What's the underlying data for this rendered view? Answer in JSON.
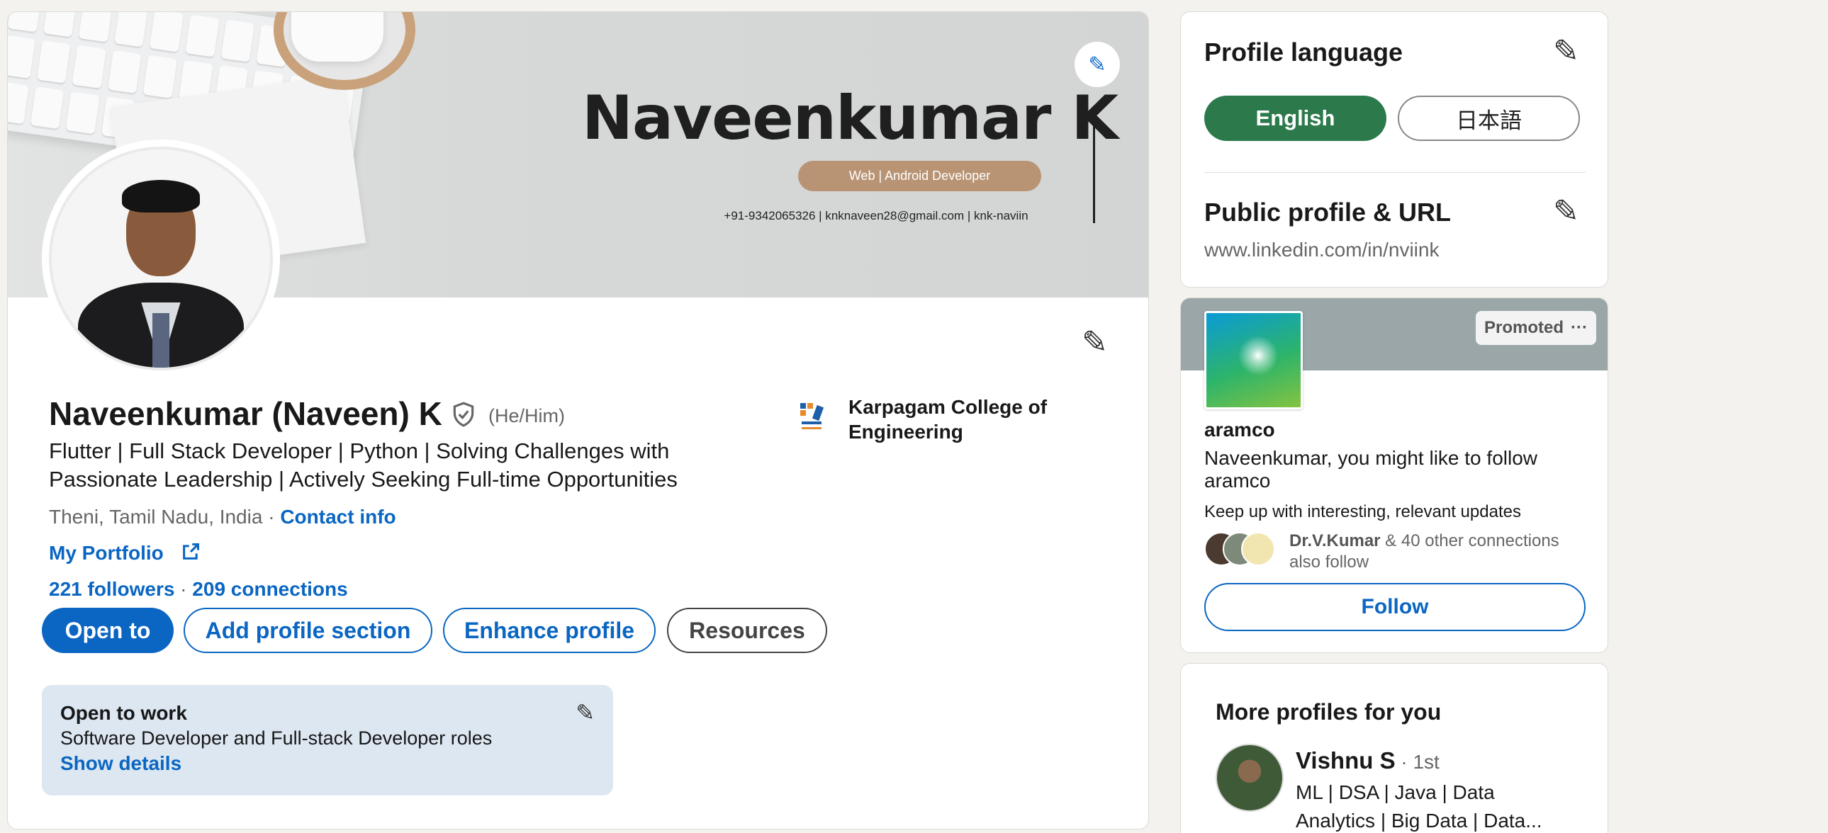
{
  "banner": {
    "name": "Naveenkumar K",
    "tagline": "Web | Android Developer",
    "contact": "+91-9342065326  |  knknaveen28@gmail.com  | knk-naviin"
  },
  "profile": {
    "name": "Naveenkumar (Naveen) K",
    "pronouns": "(He/Him)",
    "headline": "Flutter | Full Stack Developer | Python | Solving Challenges with Passionate Leadership | Actively Seeking Full-time Opportunities",
    "location": "Theni, Tamil Nadu, India",
    "location_sep": " · ",
    "contact_info": "Contact info",
    "portfolio": "My Portfolio",
    "followers": "221 followers",
    "stats_sep": " · ",
    "connections": "209 connections",
    "school": "Karpagam College of Engineering"
  },
  "actions": {
    "open_to": "Open to",
    "add_section": "Add profile section",
    "enhance": "Enhance profile",
    "resources": "Resources"
  },
  "open_to_work": {
    "title": "Open to work",
    "description": "Software Developer and Full-stack Developer roles",
    "link": "Show details"
  },
  "sidebar": {
    "language_title": "Profile language",
    "languages": [
      "English",
      "日本語"
    ],
    "public_profile_title": "Public profile & URL",
    "public_url": "www.linkedin.com/in/nviink"
  },
  "ad": {
    "promoted": "Promoted",
    "more": "···",
    "company": "aramco",
    "message": "Naveenkumar, you might like to follow aramco",
    "subtext": "Keep up with interesting, relevant updates",
    "connection_name": "Dr.V.Kumar",
    "connection_rest": " & 40 other connections also follow",
    "follow": "Follow"
  },
  "more_profiles": {
    "title": "More profiles for you",
    "name": "Vishnu S",
    "degree": " · 1st",
    "headline": "ML | DSA | Java | Data Analytics | Big Data | Data..."
  },
  "colors": {
    "brand": "#0a66c2",
    "open_to_work_bg": "#dde7f1",
    "language_selected": "#2c7a4c"
  },
  "icons": [
    "pencil-icon",
    "verified-shield-icon",
    "external-link-icon",
    "more-icon"
  ]
}
